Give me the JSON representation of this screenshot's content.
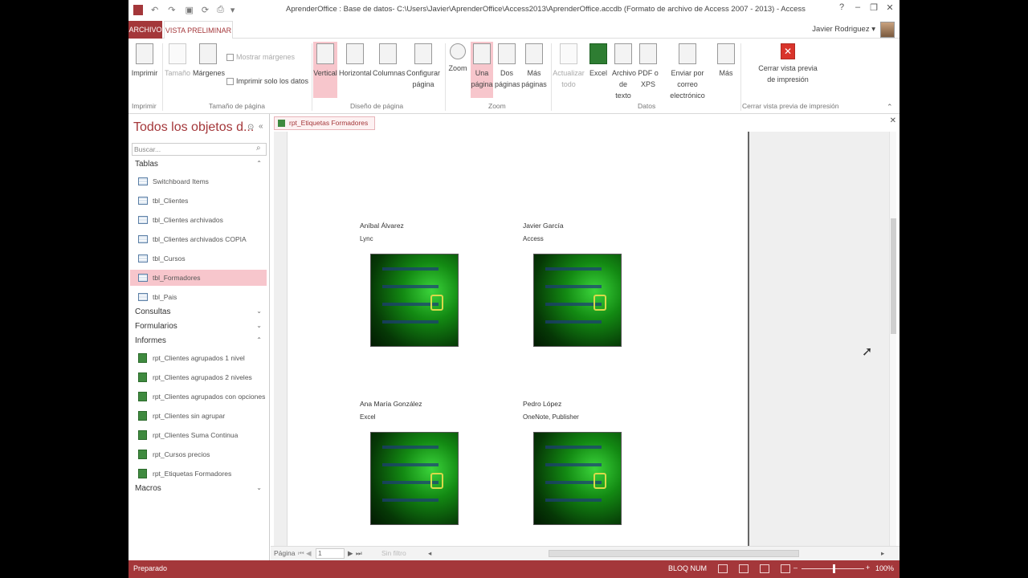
{
  "window": {
    "title": "AprenderOffice : Base de datos- C:\\Users\\Javier\\AprenderOffice\\Access2013\\AprenderOffice.accdb (Formato de archivo de Access 2007 - 2013) - Access",
    "help": "?",
    "minimize": "–",
    "restore": "❐",
    "close": "✕"
  },
  "tabs": {
    "archivo": "ARCHIVO",
    "vista": "VISTA PRELIMINAR",
    "user": "Javier Rodriguez ▾"
  },
  "ribbon": {
    "imprimir": "Imprimir",
    "tamano": "Tamaño",
    "margenes": "Márgenes",
    "mostrar_margenes": "Mostrar márgenes",
    "imprimir_solo_datos": "Imprimir solo los datos",
    "vertical": "Vertical",
    "horizontal": "Horizontal",
    "columnas": "Columnas",
    "configurar_pagina": "Configurar página",
    "zoom": "Zoom",
    "una_pagina": "Una página",
    "dos_paginas": "Dos páginas",
    "mas_paginas": "Más páginas",
    "actualizar_todo": "Actualizar todo",
    "excel": "Excel",
    "archivo_texto": "Archivo de texto",
    "pdf_xps": "PDF o XPS",
    "enviar_correo": "Enviar por correo electrónico",
    "mas": "Más",
    "cerrar_vista": "Cerrar vista previa de impresión",
    "groups": {
      "imprimir": "Imprimir",
      "tamano_pagina": "Tamaño de página",
      "diseno_pagina": "Diseño de página",
      "zoom": "Zoom",
      "datos": "Datos",
      "cerrar": "Cerrar vista previa de impresión"
    }
  },
  "nav": {
    "title": "Todos los objetos d...",
    "search_placeholder": "Buscar...",
    "sections": {
      "tablas": "Tablas",
      "consultas": "Consultas",
      "formularios": "Formularios",
      "informes": "Informes",
      "macros": "Macros"
    },
    "tables": [
      "Switchboard Items",
      "tbl_Clientes",
      "tbl_Clientes archivados",
      "tbl_Clientes archivados COPIA",
      "tbl_Cursos",
      "tbl_Formadores",
      "tbl_Pais"
    ],
    "reports": [
      "rpt_Clientes agrupados 1 nivel",
      "rpt_Clientes agrupados 2 niveles",
      "rpt_Clientes agrupados con opciones",
      "rpt_Clientes sin agrupar",
      "rpt_Clientes Suma Continua",
      "rpt_Cursos precios",
      "rpt_Etiquetas Formadores"
    ]
  },
  "document": {
    "tab": "rpt_Etiquetas Formadores",
    "labels": [
      {
        "name": "Aníbal Álvarez",
        "course": "Lync"
      },
      {
        "name": "Javier García",
        "course": "Access"
      },
      {
        "name": "Ana María González",
        "course": "Excel"
      },
      {
        "name": "Pedro López",
        "course": "OneNote, Publisher"
      }
    ]
  },
  "pager": {
    "label": "Página",
    "value": "1",
    "filter": "Sin filtro"
  },
  "status": {
    "left": "Preparado",
    "caps": "BLOQ NUM",
    "zoom": "100%"
  },
  "colors": {
    "accent": "#a4373a",
    "selected": "#f7c6cc"
  }
}
